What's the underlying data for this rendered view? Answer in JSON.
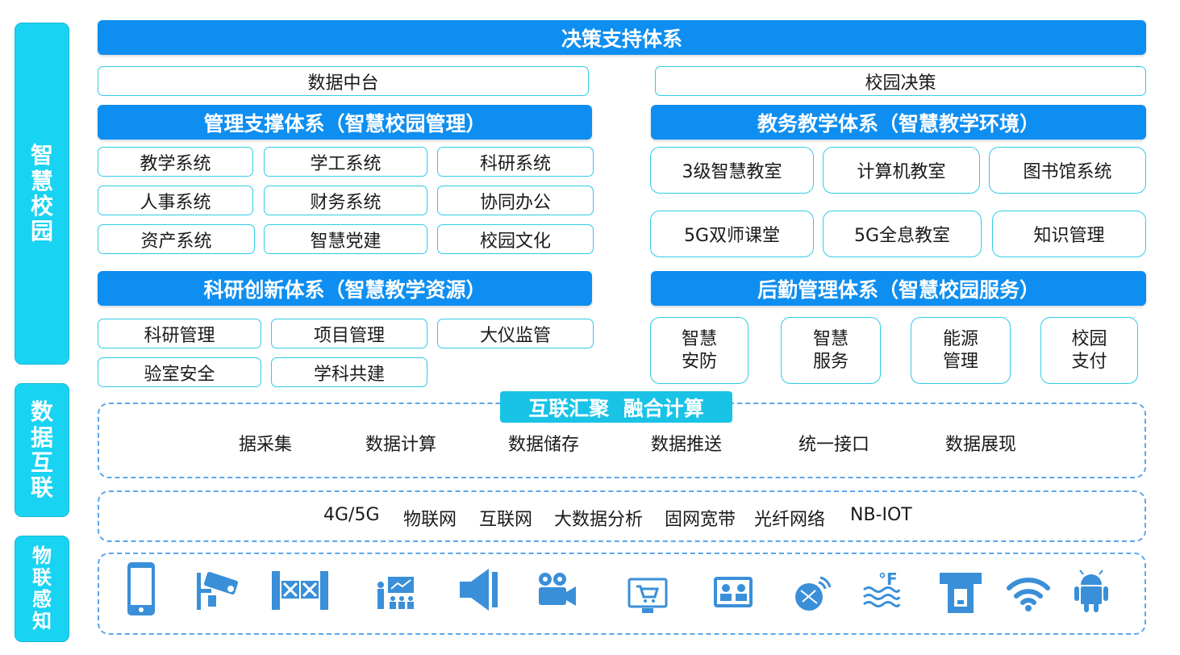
{
  "side_labels": {
    "smart_campus": "智\n慧\n校\n园",
    "data_interconnect": "数\n据\n互\n联",
    "iot_sensing": "物\n联\n感\n知"
  },
  "decision": {
    "title": "决策支持体系",
    "left": "数据中台",
    "right": "校园决策"
  },
  "management": {
    "title": "管理支撑体系（智慧校园管理）",
    "items": [
      "教学系统",
      "学工系统",
      "科研系统",
      "人事系统",
      "财务系统",
      "协同办公",
      "资产系统",
      "智慧党建",
      "校园文化"
    ]
  },
  "teaching": {
    "title": "教务教学体系（智慧教学环境）",
    "items": [
      "3级智慧教室",
      "计算机教室",
      "图书馆系统",
      "5G双师课堂",
      "5G全息教室",
      "知识管理"
    ]
  },
  "research": {
    "title": "科研创新体系（智慧教学资源）",
    "items": [
      "科研管理",
      "项目管理",
      "大仪监管",
      "验室安全",
      "学科共建"
    ]
  },
  "logistics": {
    "title": "后勤管理体系（智慧校园服务）",
    "items": [
      "智慧\n安防",
      "智慧\n服务",
      "能源\n管理",
      "校园\n支付"
    ]
  },
  "fusion": {
    "title": "互联汇聚  融合计算",
    "items": [
      "据采集",
      "数据计算",
      "数据储存",
      "数据推送",
      "统一接口",
      "数据展现"
    ]
  },
  "network": {
    "items": [
      "4G/5G",
      "物联网",
      "互联网",
      "大数据分析",
      "固网宽带",
      "光纤网络",
      "NB-IOT"
    ]
  },
  "devices": {
    "icons": [
      "phone-icon",
      "cctv-camera-icon",
      "gate-icon",
      "classroom-display-icon",
      "speaker-icon",
      "video-camera-icon",
      "pos-terminal-icon",
      "id-reader-icon",
      "satellite-dish-icon",
      "water-temperature-icon",
      "card-machine-icon",
      "wifi-icon",
      "android-icon"
    ]
  },
  "colors": {
    "band_blue": "#0e8ef0",
    "side_cyan": "#19d3f2",
    "border_cyan": "#2fcbe6",
    "icon_blue": "#3a8fd8"
  }
}
